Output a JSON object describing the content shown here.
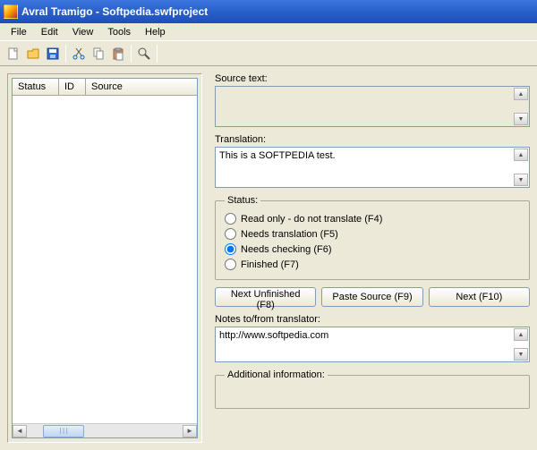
{
  "window": {
    "title": "Avral Tramigo - Softpedia.swfproject"
  },
  "menu": {
    "file": "File",
    "edit": "Edit",
    "view": "View",
    "tools": "Tools",
    "help": "Help"
  },
  "list": {
    "col_status": "Status",
    "col_id": "ID",
    "col_source": "Source"
  },
  "labels": {
    "source_text": "Source text:",
    "translation": "Translation:",
    "status_legend": "Status:",
    "notes": "Notes to/from translator:",
    "additional": "Additional information:"
  },
  "values": {
    "source_text": "",
    "translation": "This is a SOFTPEDIA test.",
    "notes": "http://www.softpedia.com"
  },
  "status_options": {
    "readonly": "Read only - do not translate (F4)",
    "needs_translation": "Needs translation (F5)",
    "needs_checking": "Needs checking (F6)",
    "finished": "Finished (F7)",
    "selected": "needs_checking"
  },
  "buttons": {
    "next_unfinished": "Next Unfinished (F8)",
    "paste_source": "Paste Source (F9)",
    "next": "Next (F10)"
  }
}
